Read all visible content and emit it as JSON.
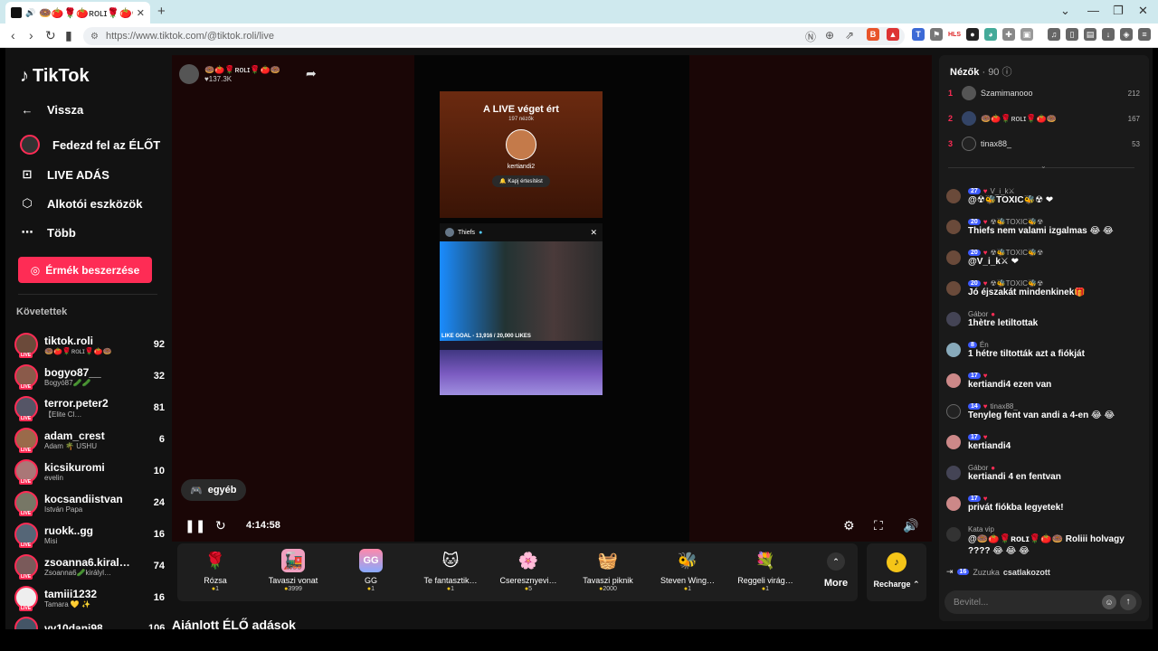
{
  "browser": {
    "tab_title": "🍩🍅🌹🍅ʀᴏʟɪ🌹🍅🍩 (@tikt",
    "url": "https://www.tiktok.com/@tiktok.roli/live"
  },
  "sidebar": {
    "logo": "TikTok",
    "nav": [
      {
        "label": "Vissza",
        "icon": "arrow-left-icon"
      },
      {
        "label": "Fedezd fel az ÉLŐT",
        "icon": "live-avatar-icon"
      },
      {
        "label": "LIVE ADÁS",
        "icon": "video-camera-icon"
      },
      {
        "label": "Alkotói eszközök",
        "icon": "creator-tools-icon"
      },
      {
        "label": "Több",
        "icon": "more-dots-icon"
      }
    ],
    "coins_button": "Érmék beszerzése",
    "following_title": "Követettek",
    "following": [
      {
        "name": "tiktok.roli",
        "sub": "🍩🍅🌹ʀᴏʟɪ🌹🍅🍩",
        "count": "92"
      },
      {
        "name": "bogyo87__",
        "sub": "Bogyó87🥒🥒",
        "count": "32"
      },
      {
        "name": "terror.peter2",
        "sub": "【Elite Cl…",
        "count": "81"
      },
      {
        "name": "adam_crest",
        "sub": "Adam 🌴 USHU",
        "count": "6"
      },
      {
        "name": "kicsikuromi",
        "sub": "evelin",
        "count": "10"
      },
      {
        "name": "kocsandiistvan",
        "sub": "István Papa",
        "count": "24"
      },
      {
        "name": "ruokk..gg",
        "sub": "Misi",
        "count": "16"
      },
      {
        "name": "zsoanna6.kiral…",
        "sub": "Zsoanna6🥒királyl…",
        "count": "74"
      },
      {
        "name": "tamiii1232",
        "sub": "Tamara 💛 ✨",
        "count": "16"
      },
      {
        "name": "vv10dani98",
        "sub": "",
        "count": "106"
      }
    ]
  },
  "stream": {
    "host_name": "🍩🍅🌹ʀᴏʟɪ🌹🍅🍩",
    "host_likes": "137.3K",
    "ended_title": "A LIVE véget ért",
    "ended_viewers": "197 nézők",
    "ended_user": "kertiandi2",
    "notify_button": "Kapj értesítést",
    "mini_name": "Thiefs",
    "like_goal": "LIKE GOAL - 13,916 / 20,000 LIKES",
    "category": "egyéb",
    "time": "4:14:58"
  },
  "gifts": [
    {
      "name": "Rózsa",
      "price": "1",
      "icon": "🌹"
    },
    {
      "name": "Tavaszi vonat",
      "price": "3999",
      "icon": "🚂"
    },
    {
      "name": "GG",
      "price": "1",
      "icon": "GG"
    },
    {
      "name": "Te fantasztik…",
      "price": "1",
      "icon": "🐱"
    },
    {
      "name": "Cseresznyevi…",
      "price": "5",
      "icon": "🌸"
    },
    {
      "name": "Tavaszi piknik",
      "price": "2000",
      "icon": "🧺"
    },
    {
      "name": "Steven Wing…",
      "price": "1",
      "icon": "🐝"
    },
    {
      "name": "Reggeli virág…",
      "price": "1",
      "icon": "💐"
    }
  ],
  "more_label": "More",
  "recharge_label": "Recharge",
  "recommended_title": "Ajánlott ÉLŐ adások",
  "chat": {
    "viewers_label": "Nézők",
    "viewers_count": "· 90",
    "top_viewers": [
      {
        "rank": "1",
        "name": "Szamimanooo",
        "score": "212"
      },
      {
        "rank": "2",
        "name": "🍩🍅🌹ʀᴏʟɪ🌹🍅🍩",
        "score": "167"
      },
      {
        "rank": "3",
        "name": "tinax88_",
        "score": "53"
      }
    ],
    "messages": [
      {
        "level": "27",
        "user": "V_i_k⚔",
        "text": "@☢🐝TOXIC🐝☢ ❤"
      },
      {
        "level": "20",
        "user": "☢🐝TOXIC🐝☢",
        "text": "Thiefs nem valami izgalmas 😂 😂"
      },
      {
        "level": "20",
        "user": "☢🐝TOXIC🐝☢",
        "text": "@V_i_k⚔ ❤"
      },
      {
        "level": "20",
        "user": "☢🐝TOXIC🐝☢",
        "text": "Jó éjszakát mindenkinek🎁"
      },
      {
        "level": "",
        "user": "Gábor",
        "text": "1hètre letiltottak"
      },
      {
        "level": "8",
        "user": "Én",
        "text": "1 hétre tiltották azt a fiókját"
      },
      {
        "level": "17",
        "user": "",
        "text": "kertiandi4 ezen van"
      },
      {
        "level": "14",
        "user": "tinax88_",
        "text": "Tenyleg fent van andi a 4-en 😂 😂"
      },
      {
        "level": "17",
        "user": "",
        "text": "kertiandi4"
      },
      {
        "level": "",
        "user": "Gábor",
        "text": "kertiandi 4 en fentvan"
      },
      {
        "level": "17",
        "user": "",
        "text": "privát fiókba legyetek!"
      },
      {
        "level": "",
        "user": "Kata vip",
        "text": "@🍩🍅🌹ʀᴏʟɪ🌹🍅🍩 Roliii holvagy ???? 😂 😂 😂"
      }
    ],
    "join_level": "16",
    "join_user": "Zuzuka",
    "join_text": "csatlakozott",
    "input_placeholder": "Bevitel..."
  }
}
